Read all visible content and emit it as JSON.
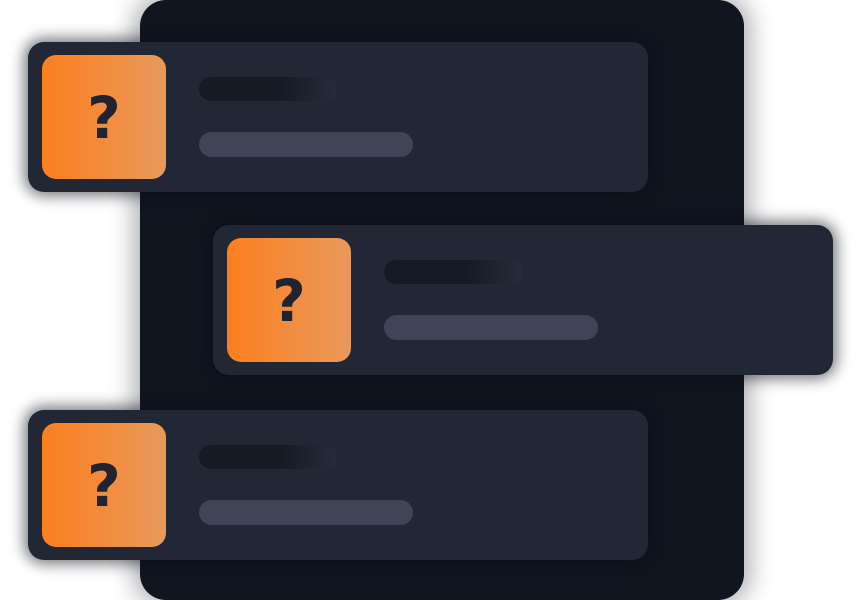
{
  "cards": [
    {
      "tile": {
        "icon": "question-mark-icon",
        "glyph": "?"
      }
    },
    {
      "tile": {
        "icon": "question-mark-icon",
        "glyph": "?"
      }
    },
    {
      "tile": {
        "icon": "question-mark-icon",
        "glyph": "?"
      }
    }
  ],
  "colors": {
    "backdrop": "#111520",
    "card": "#212735",
    "accent_start": "#fb7f1e",
    "accent_end": "#e9995c",
    "glyph": "#20242f",
    "placeholder_dark": "#161a25",
    "placeholder_light": "#3f4556"
  }
}
